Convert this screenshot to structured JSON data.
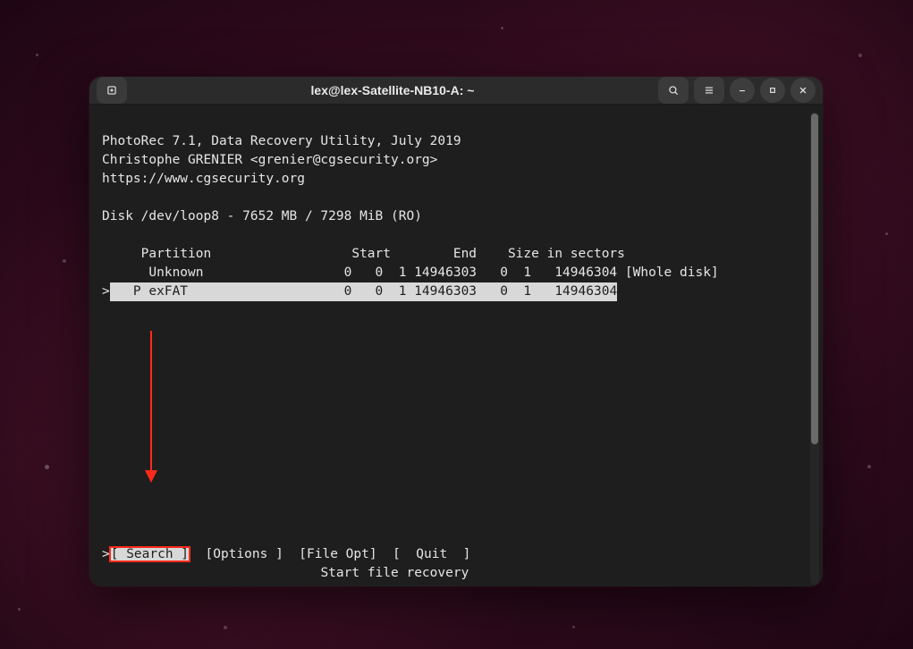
{
  "window": {
    "title": "lex@lex-Satellite-NB10-A: ~"
  },
  "app": {
    "header_line1": "PhotoRec 7.1, Data Recovery Utility, July 2019",
    "header_line2": "Christophe GRENIER <grenier@cgsecurity.org>",
    "header_line3": "https://www.cgsecurity.org",
    "disk_line": "Disk /dev/loop8 - 7652 MB / 7298 MiB (RO)",
    "columns": "     Partition                  Start        End    Size in sectors",
    "rows": {
      "r0": "      Unknown                  0   0  1 14946303   0  1   14946304 [Whole disk]",
      "r1_prefix": ">",
      "r1_hl": "   P exFAT                    0   0  1 14946303   0  1   14946304"
    },
    "menu": {
      "prefix": ">",
      "search": "[ Search ]",
      "options": "[Options ]",
      "fileopt": "[File Opt]",
      "quit": "[  Quit  ]",
      "hint": "Start file recovery"
    }
  }
}
